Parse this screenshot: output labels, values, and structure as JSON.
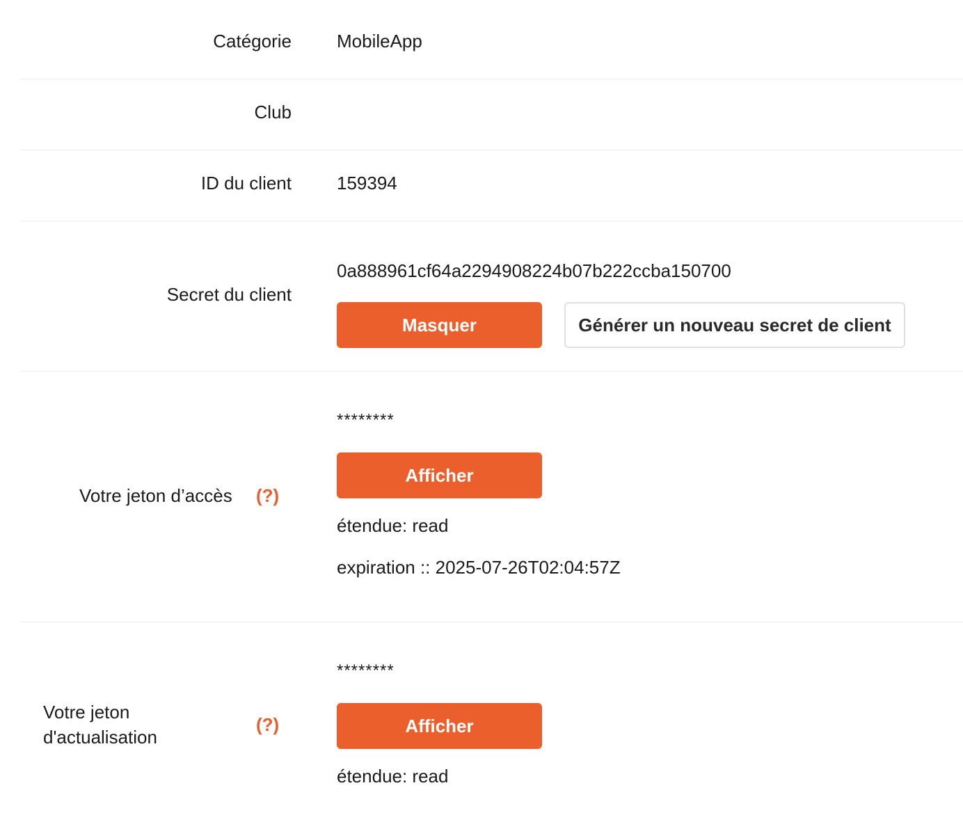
{
  "fields": {
    "category": {
      "label": "Catégorie",
      "value": "MobileApp"
    },
    "club": {
      "label": "Club",
      "value": ""
    },
    "client_id": {
      "label": "ID du client",
      "value": "159394"
    },
    "client_secret": {
      "label": "Secret du client",
      "value": "0a888961cf64a2294908224b07b222ccba150700",
      "hide_button": "Masquer",
      "regenerate_button": "Générer un nouveau secret de client"
    },
    "access_token": {
      "label": "Votre jeton d’accès",
      "help": "(?)",
      "masked": "********",
      "show_button": "Afficher",
      "scope": "étendue: read",
      "expiration": "expiration :: 2025-07-26T02:04:57Z"
    },
    "refresh_token": {
      "label_line1": "Votre jeton",
      "label_line2": "d'actualisation",
      "help": "(?)",
      "masked": "********",
      "show_button": "Afficher",
      "scope": "étendue: read"
    }
  },
  "colors": {
    "accent": "#ea5f2c",
    "divider": "#ebebeb"
  }
}
